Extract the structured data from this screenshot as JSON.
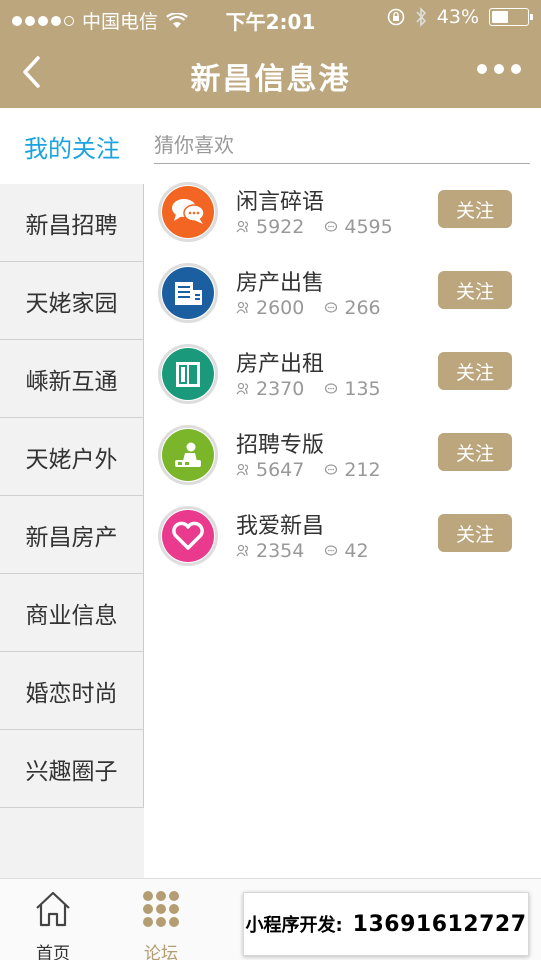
{
  "status": {
    "carrier": "中国电信",
    "time": "下午2:01",
    "battery": "43%",
    "battery_level": 0.43
  },
  "nav": {
    "title": "新昌信息港"
  },
  "sidebar": {
    "selected": "我的关注",
    "items": [
      {
        "label": "新昌招聘"
      },
      {
        "label": "天姥家园"
      },
      {
        "label": "嵊新互通"
      },
      {
        "label": "天姥户外"
      },
      {
        "label": "新昌房产"
      },
      {
        "label": "商业信息"
      },
      {
        "label": "婚恋时尚"
      },
      {
        "label": "兴趣圈子"
      }
    ]
  },
  "search": {
    "placeholder": "猜你喜欢"
  },
  "boards": [
    {
      "name": "闲言碎语",
      "members": "5922",
      "posts": "4595",
      "follow": "关注",
      "color": "#f26522",
      "icon": "chat-bubbles-icon"
    },
    {
      "name": "房产出售",
      "members": "2600",
      "posts": "266",
      "follow": "关注",
      "color": "#1c5fa0",
      "icon": "building-icon"
    },
    {
      "name": "房产出租",
      "members": "2370",
      "posts": "135",
      "follow": "关注",
      "color": "#1a9a7a",
      "icon": "door-icon"
    },
    {
      "name": "招聘专版",
      "members": "5647",
      "posts": "212",
      "follow": "关注",
      "color": "#7ab52a",
      "icon": "worker-icon"
    },
    {
      "name": "我爱新昌",
      "members": "2354",
      "posts": "42",
      "follow": "关注",
      "color": "#e93a8e",
      "icon": "heart-icon"
    }
  ],
  "tabbar": {
    "home": "首页",
    "forum": "论坛"
  },
  "promo": {
    "label": "小程序开发:",
    "phone": "13691612727"
  },
  "colors": {
    "brand": "#bca67d",
    "accent": "#1aa3e0"
  }
}
